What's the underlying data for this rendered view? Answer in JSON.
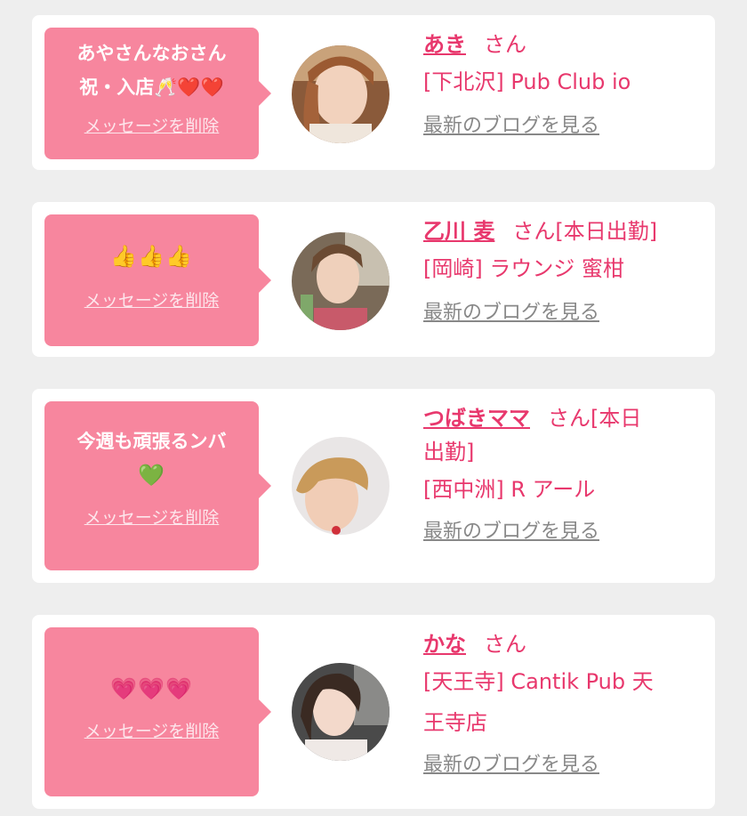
{
  "cards": [
    {
      "message_line1": "あやさんなおさん",
      "message_line2": "祝・入店🥂❤️❤️",
      "delete_label": "メッセージを削除",
      "name": "あき",
      "suffix": "さん",
      "shop": "[下北沢] Pub Club io",
      "blog_label": "最新のブログを見る"
    },
    {
      "message_line1": "👍👍👍",
      "delete_label": "メッセージを削除",
      "name": "乙川 麦",
      "suffix": "さん[本日出勤]",
      "shop": "[岡崎] ラウンジ 蜜柑",
      "blog_label": "最新のブログを見る"
    },
    {
      "message_line1": "今週も頑張るンバ",
      "message_line2": "💚",
      "delete_label": "メッセージを削除",
      "name": "つばきママ",
      "suffix": "さん[本日",
      "suffix_line2": "出勤]",
      "shop": "[西中洲] R アール",
      "blog_label": "最新のブログを見る"
    },
    {
      "message_line1": "💗💗💗",
      "delete_label": "メッセージを削除",
      "name": "かな",
      "suffix": "さん",
      "shop": "[天王寺] Cantik Pub 天",
      "shop_line2": "王寺店",
      "blog_label": "最新のブログを見る"
    }
  ],
  "colors": {
    "bubble": "#f7869e",
    "accent": "#e8386d",
    "link_gray": "#888888"
  }
}
